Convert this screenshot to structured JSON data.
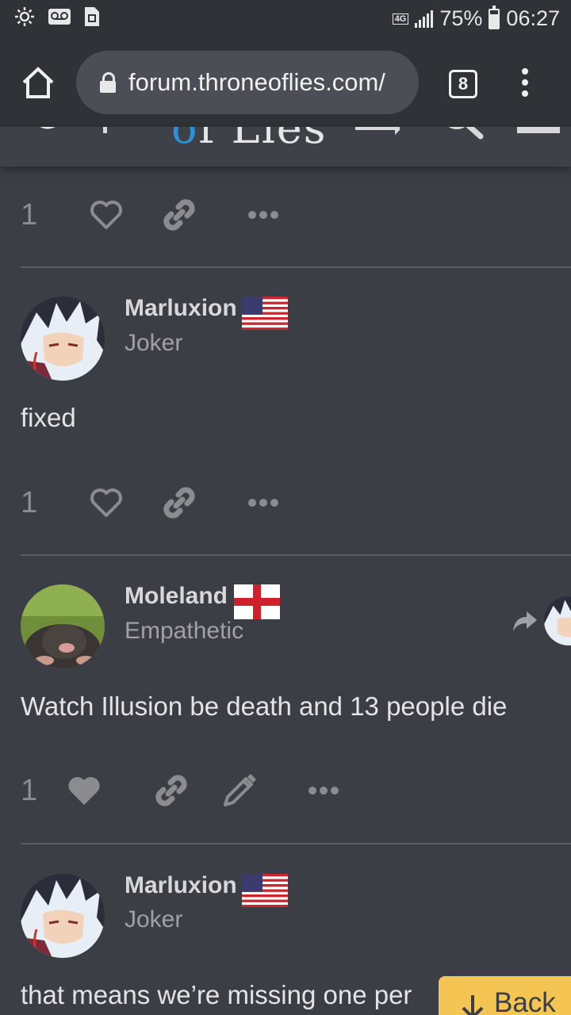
{
  "status_bar": {
    "network": "4G",
    "battery": "75%",
    "battery_level": 0.75,
    "time": "06:27",
    "icons": [
      "brightness-icon",
      "voicemail-icon",
      "sim-icon",
      "signal-icon",
      "battery-icon"
    ]
  },
  "browser": {
    "url": "forum.throneoflies.com/",
    "tab_count": "8",
    "icons": [
      "home-icon",
      "lock-icon",
      "overflow-menu-icon"
    ]
  },
  "forum_header": {
    "logo_text": "OF LIES",
    "icons": [
      "chat-icon",
      "search-icon",
      "hamburger-icon"
    ]
  },
  "posts": [
    {
      "like_count": "1",
      "liked": false,
      "actions": [
        "like-icon",
        "link-icon",
        "more-icon"
      ]
    },
    {
      "username": "Marluxion",
      "user_title": "Joker",
      "flag": "us-flag",
      "body": "fixed",
      "like_count": "1",
      "liked": false,
      "actions": [
        "like-icon",
        "link-icon",
        "more-icon"
      ]
    },
    {
      "username": "Moleland",
      "user_title": "Empathetic",
      "flag": "england-flag",
      "body": "Watch Illusion be death and 13 people die",
      "like_count": "1",
      "liked": true,
      "actions": [
        "like-icon",
        "link-icon",
        "edit-icon",
        "more-icon"
      ]
    },
    {
      "username": "Marluxion",
      "user_title": "Joker",
      "flag": "us-flag",
      "body": "that means we’re missing one per"
    }
  ],
  "back_button": {
    "label": "Back"
  },
  "colors": {
    "background": "#3b3e45",
    "bars": "#2f3236",
    "accent": "#f4c553"
  }
}
